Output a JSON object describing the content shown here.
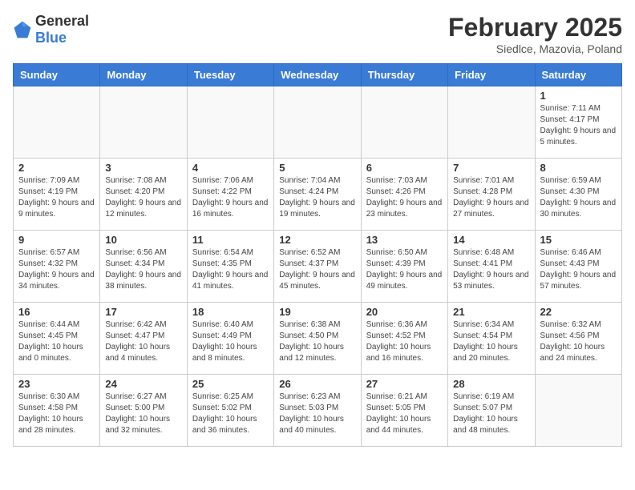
{
  "logo": {
    "general": "General",
    "blue": "Blue"
  },
  "title": "February 2025",
  "subtitle": "Siedlce, Mazovia, Poland",
  "weekdays": [
    "Sunday",
    "Monday",
    "Tuesday",
    "Wednesday",
    "Thursday",
    "Friday",
    "Saturday"
  ],
  "weeks": [
    [
      {
        "day": "",
        "info": ""
      },
      {
        "day": "",
        "info": ""
      },
      {
        "day": "",
        "info": ""
      },
      {
        "day": "",
        "info": ""
      },
      {
        "day": "",
        "info": ""
      },
      {
        "day": "",
        "info": ""
      },
      {
        "day": "1",
        "info": "Sunrise: 7:11 AM\nSunset: 4:17 PM\nDaylight: 9 hours and 5 minutes."
      }
    ],
    [
      {
        "day": "2",
        "info": "Sunrise: 7:09 AM\nSunset: 4:19 PM\nDaylight: 9 hours and 9 minutes."
      },
      {
        "day": "3",
        "info": "Sunrise: 7:08 AM\nSunset: 4:20 PM\nDaylight: 9 hours and 12 minutes."
      },
      {
        "day": "4",
        "info": "Sunrise: 7:06 AM\nSunset: 4:22 PM\nDaylight: 9 hours and 16 minutes."
      },
      {
        "day": "5",
        "info": "Sunrise: 7:04 AM\nSunset: 4:24 PM\nDaylight: 9 hours and 19 minutes."
      },
      {
        "day": "6",
        "info": "Sunrise: 7:03 AM\nSunset: 4:26 PM\nDaylight: 9 hours and 23 minutes."
      },
      {
        "day": "7",
        "info": "Sunrise: 7:01 AM\nSunset: 4:28 PM\nDaylight: 9 hours and 27 minutes."
      },
      {
        "day": "8",
        "info": "Sunrise: 6:59 AM\nSunset: 4:30 PM\nDaylight: 9 hours and 30 minutes."
      }
    ],
    [
      {
        "day": "9",
        "info": "Sunrise: 6:57 AM\nSunset: 4:32 PM\nDaylight: 9 hours and 34 minutes."
      },
      {
        "day": "10",
        "info": "Sunrise: 6:56 AM\nSunset: 4:34 PM\nDaylight: 9 hours and 38 minutes."
      },
      {
        "day": "11",
        "info": "Sunrise: 6:54 AM\nSunset: 4:35 PM\nDaylight: 9 hours and 41 minutes."
      },
      {
        "day": "12",
        "info": "Sunrise: 6:52 AM\nSunset: 4:37 PM\nDaylight: 9 hours and 45 minutes."
      },
      {
        "day": "13",
        "info": "Sunrise: 6:50 AM\nSunset: 4:39 PM\nDaylight: 9 hours and 49 minutes."
      },
      {
        "day": "14",
        "info": "Sunrise: 6:48 AM\nSunset: 4:41 PM\nDaylight: 9 hours and 53 minutes."
      },
      {
        "day": "15",
        "info": "Sunrise: 6:46 AM\nSunset: 4:43 PM\nDaylight: 9 hours and 57 minutes."
      }
    ],
    [
      {
        "day": "16",
        "info": "Sunrise: 6:44 AM\nSunset: 4:45 PM\nDaylight: 10 hours and 0 minutes."
      },
      {
        "day": "17",
        "info": "Sunrise: 6:42 AM\nSunset: 4:47 PM\nDaylight: 10 hours and 4 minutes."
      },
      {
        "day": "18",
        "info": "Sunrise: 6:40 AM\nSunset: 4:49 PM\nDaylight: 10 hours and 8 minutes."
      },
      {
        "day": "19",
        "info": "Sunrise: 6:38 AM\nSunset: 4:50 PM\nDaylight: 10 hours and 12 minutes."
      },
      {
        "day": "20",
        "info": "Sunrise: 6:36 AM\nSunset: 4:52 PM\nDaylight: 10 hours and 16 minutes."
      },
      {
        "day": "21",
        "info": "Sunrise: 6:34 AM\nSunset: 4:54 PM\nDaylight: 10 hours and 20 minutes."
      },
      {
        "day": "22",
        "info": "Sunrise: 6:32 AM\nSunset: 4:56 PM\nDaylight: 10 hours and 24 minutes."
      }
    ],
    [
      {
        "day": "23",
        "info": "Sunrise: 6:30 AM\nSunset: 4:58 PM\nDaylight: 10 hours and 28 minutes."
      },
      {
        "day": "24",
        "info": "Sunrise: 6:27 AM\nSunset: 5:00 PM\nDaylight: 10 hours and 32 minutes."
      },
      {
        "day": "25",
        "info": "Sunrise: 6:25 AM\nSunset: 5:02 PM\nDaylight: 10 hours and 36 minutes."
      },
      {
        "day": "26",
        "info": "Sunrise: 6:23 AM\nSunset: 5:03 PM\nDaylight: 10 hours and 40 minutes."
      },
      {
        "day": "27",
        "info": "Sunrise: 6:21 AM\nSunset: 5:05 PM\nDaylight: 10 hours and 44 minutes."
      },
      {
        "day": "28",
        "info": "Sunrise: 6:19 AM\nSunset: 5:07 PM\nDaylight: 10 hours and 48 minutes."
      },
      {
        "day": "",
        "info": ""
      }
    ]
  ]
}
